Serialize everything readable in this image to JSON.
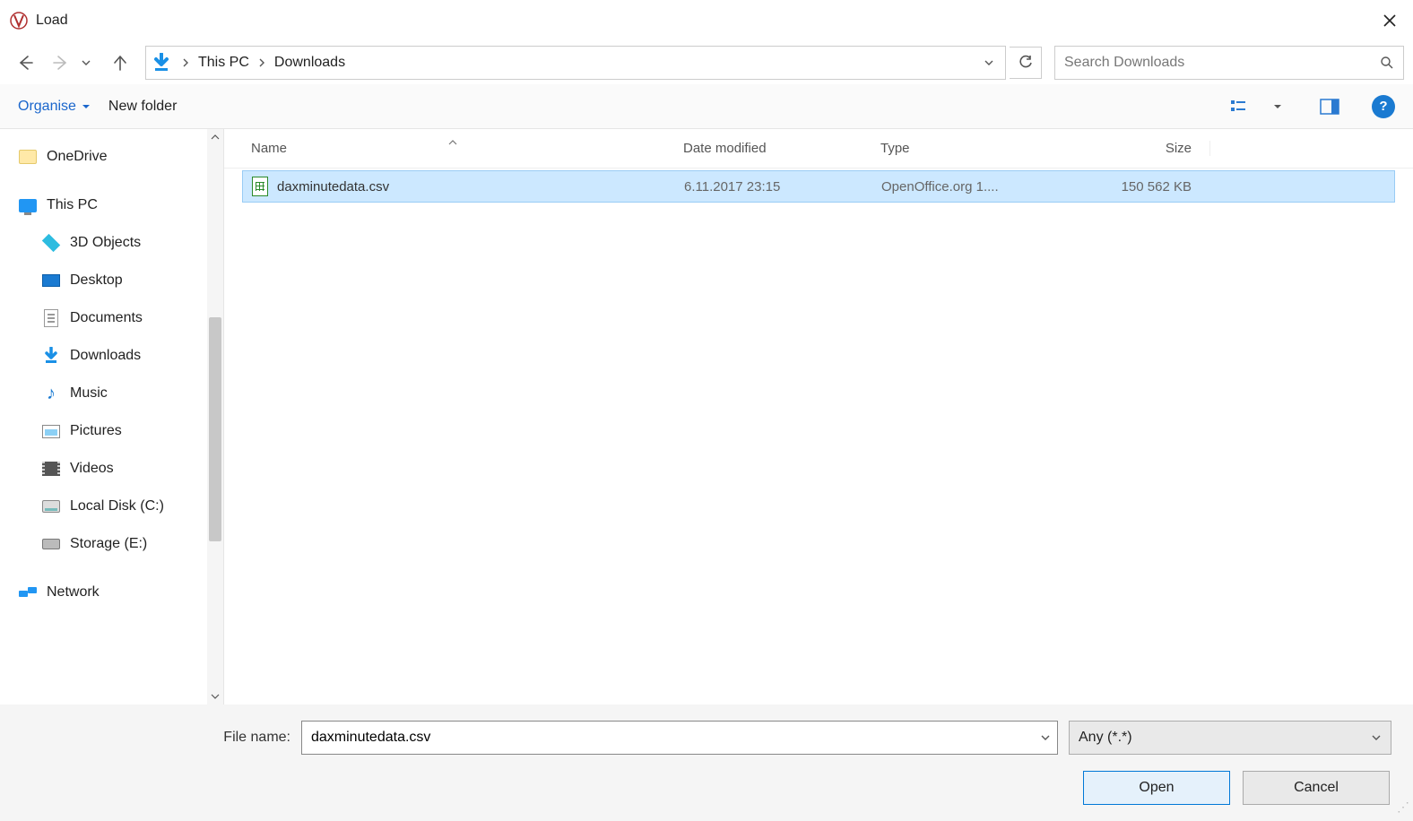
{
  "window": {
    "title": "Load"
  },
  "nav": {
    "path": [
      "This PC",
      "Downloads"
    ]
  },
  "search": {
    "placeholder": "Search Downloads"
  },
  "toolbar": {
    "organise": "Organise",
    "new_folder": "New folder"
  },
  "sidebar": {
    "items": [
      {
        "id": "onedrive",
        "label": "OneDrive",
        "indent": false
      },
      {
        "id": "this-pc",
        "label": "This PC",
        "indent": false
      },
      {
        "id": "3d",
        "label": "3D Objects",
        "indent": true
      },
      {
        "id": "desktop",
        "label": "Desktop",
        "indent": true
      },
      {
        "id": "documents",
        "label": "Documents",
        "indent": true
      },
      {
        "id": "downloads",
        "label": "Downloads",
        "indent": true
      },
      {
        "id": "music",
        "label": "Music",
        "indent": true
      },
      {
        "id": "pictures",
        "label": "Pictures",
        "indent": true
      },
      {
        "id": "videos",
        "label": "Videos",
        "indent": true
      },
      {
        "id": "localdisk",
        "label": "Local Disk (C:)",
        "indent": true
      },
      {
        "id": "storage",
        "label": "Storage (E:)",
        "indent": true
      },
      {
        "id": "network",
        "label": "Network",
        "indent": false
      }
    ]
  },
  "columns": {
    "name": "Name",
    "date": "Date modified",
    "type": "Type",
    "size": "Size"
  },
  "files": [
    {
      "name": "daxminutedata.csv",
      "date": "6.11.2017 23:15",
      "type": "OpenOffice.org 1....",
      "size": "150 562 KB"
    }
  ],
  "footer": {
    "file_name_label": "File name:",
    "file_name_value": "daxminutedata.csv",
    "filter": "Any (*.*)",
    "open": "Open",
    "cancel": "Cancel"
  }
}
